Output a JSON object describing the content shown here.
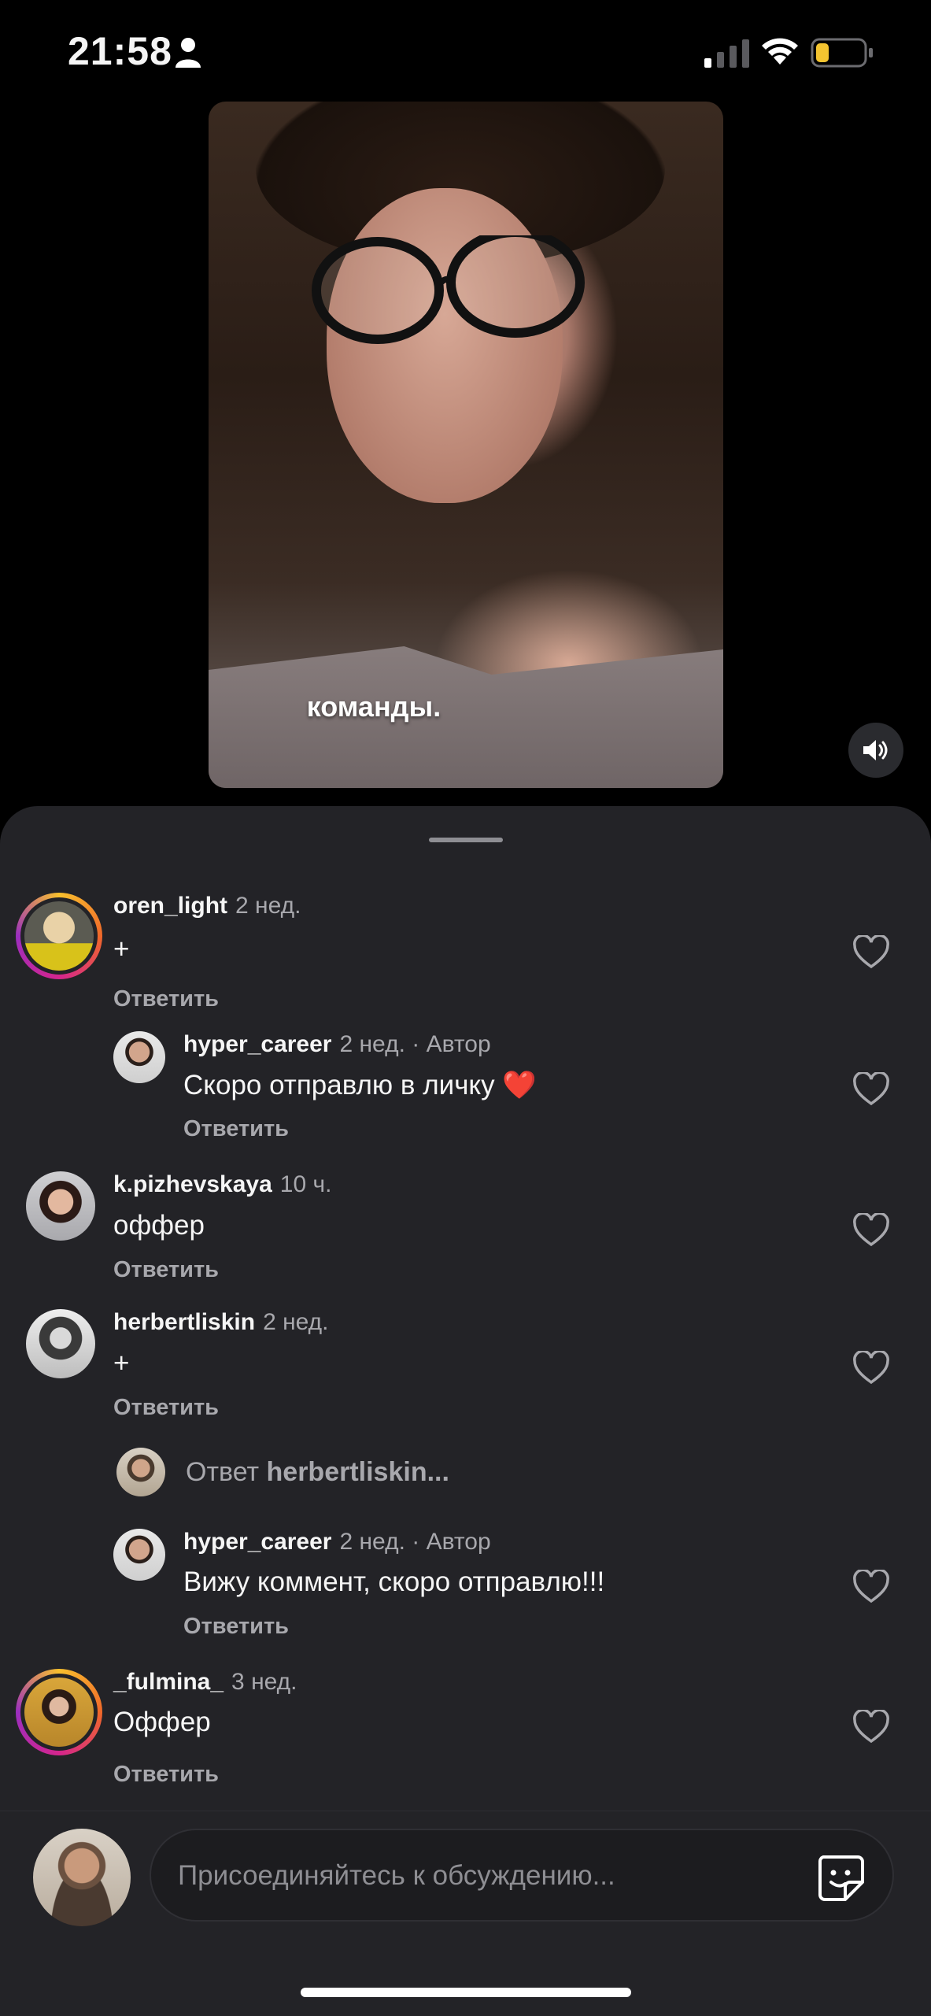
{
  "status_bar": {
    "time": "21:58",
    "battery_color": "#f4c430"
  },
  "video": {
    "caption": "команды."
  },
  "comments": [
    {
      "username": "oren_light",
      "time": "2 нед.",
      "text": "+",
      "reply": "Ответить"
    },
    {
      "username": "hyper_career",
      "time": "2 нед. · Автор",
      "text": "Скоро отправлю в личку ❤️",
      "reply": "Ответить"
    },
    {
      "username": "k.pizhevskaya",
      "time": "10 ч.",
      "text": "оффер",
      "reply": "Ответить"
    },
    {
      "username": "herbertliskin",
      "time": "2 нед.",
      "text": "+",
      "reply": "Ответить"
    },
    {
      "username": "hyper_career",
      "time": "2 нед. · Автор",
      "text": "Вижу коммент, скоро отправлю!!!",
      "reply": "Ответить"
    },
    {
      "username": "_fulmina_",
      "time": "3 нед.",
      "text": "Оффер",
      "reply": "Ответить"
    }
  ],
  "reply_thread": {
    "prefix": "Ответ",
    "target": "herbertliskin..."
  },
  "composer": {
    "placeholder": "Присоединяйтесь к обсуждению..."
  }
}
